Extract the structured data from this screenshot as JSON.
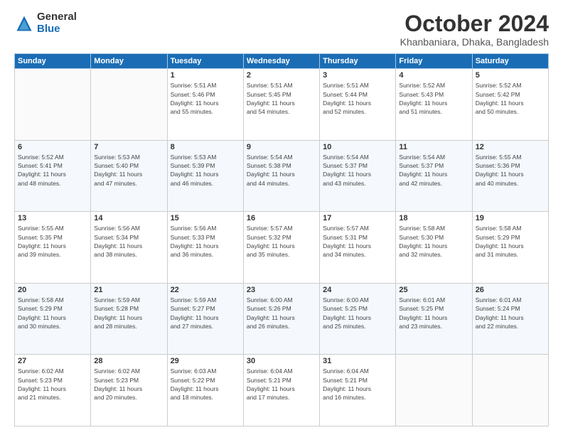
{
  "logo": {
    "general": "General",
    "blue": "Blue"
  },
  "header": {
    "month": "October 2024",
    "location": "Khanbaniara, Dhaka, Bangladesh"
  },
  "days_of_week": [
    "Sunday",
    "Monday",
    "Tuesday",
    "Wednesday",
    "Thursday",
    "Friday",
    "Saturday"
  ],
  "weeks": [
    [
      {
        "day": "",
        "info": ""
      },
      {
        "day": "",
        "info": ""
      },
      {
        "day": "1",
        "info": "Sunrise: 5:51 AM\nSunset: 5:46 PM\nDaylight: 11 hours\nand 55 minutes."
      },
      {
        "day": "2",
        "info": "Sunrise: 5:51 AM\nSunset: 5:45 PM\nDaylight: 11 hours\nand 54 minutes."
      },
      {
        "day": "3",
        "info": "Sunrise: 5:51 AM\nSunset: 5:44 PM\nDaylight: 11 hours\nand 52 minutes."
      },
      {
        "day": "4",
        "info": "Sunrise: 5:52 AM\nSunset: 5:43 PM\nDaylight: 11 hours\nand 51 minutes."
      },
      {
        "day": "5",
        "info": "Sunrise: 5:52 AM\nSunset: 5:42 PM\nDaylight: 11 hours\nand 50 minutes."
      }
    ],
    [
      {
        "day": "6",
        "info": "Sunrise: 5:52 AM\nSunset: 5:41 PM\nDaylight: 11 hours\nand 48 minutes."
      },
      {
        "day": "7",
        "info": "Sunrise: 5:53 AM\nSunset: 5:40 PM\nDaylight: 11 hours\nand 47 minutes."
      },
      {
        "day": "8",
        "info": "Sunrise: 5:53 AM\nSunset: 5:39 PM\nDaylight: 11 hours\nand 46 minutes."
      },
      {
        "day": "9",
        "info": "Sunrise: 5:54 AM\nSunset: 5:38 PM\nDaylight: 11 hours\nand 44 minutes."
      },
      {
        "day": "10",
        "info": "Sunrise: 5:54 AM\nSunset: 5:37 PM\nDaylight: 11 hours\nand 43 minutes."
      },
      {
        "day": "11",
        "info": "Sunrise: 5:54 AM\nSunset: 5:37 PM\nDaylight: 11 hours\nand 42 minutes."
      },
      {
        "day": "12",
        "info": "Sunrise: 5:55 AM\nSunset: 5:36 PM\nDaylight: 11 hours\nand 40 minutes."
      }
    ],
    [
      {
        "day": "13",
        "info": "Sunrise: 5:55 AM\nSunset: 5:35 PM\nDaylight: 11 hours\nand 39 minutes."
      },
      {
        "day": "14",
        "info": "Sunrise: 5:56 AM\nSunset: 5:34 PM\nDaylight: 11 hours\nand 38 minutes."
      },
      {
        "day": "15",
        "info": "Sunrise: 5:56 AM\nSunset: 5:33 PM\nDaylight: 11 hours\nand 36 minutes."
      },
      {
        "day": "16",
        "info": "Sunrise: 5:57 AM\nSunset: 5:32 PM\nDaylight: 11 hours\nand 35 minutes."
      },
      {
        "day": "17",
        "info": "Sunrise: 5:57 AM\nSunset: 5:31 PM\nDaylight: 11 hours\nand 34 minutes."
      },
      {
        "day": "18",
        "info": "Sunrise: 5:58 AM\nSunset: 5:30 PM\nDaylight: 11 hours\nand 32 minutes."
      },
      {
        "day": "19",
        "info": "Sunrise: 5:58 AM\nSunset: 5:29 PM\nDaylight: 11 hours\nand 31 minutes."
      }
    ],
    [
      {
        "day": "20",
        "info": "Sunrise: 5:58 AM\nSunset: 5:29 PM\nDaylight: 11 hours\nand 30 minutes."
      },
      {
        "day": "21",
        "info": "Sunrise: 5:59 AM\nSunset: 5:28 PM\nDaylight: 11 hours\nand 28 minutes."
      },
      {
        "day": "22",
        "info": "Sunrise: 5:59 AM\nSunset: 5:27 PM\nDaylight: 11 hours\nand 27 minutes."
      },
      {
        "day": "23",
        "info": "Sunrise: 6:00 AM\nSunset: 5:26 PM\nDaylight: 11 hours\nand 26 minutes."
      },
      {
        "day": "24",
        "info": "Sunrise: 6:00 AM\nSunset: 5:25 PM\nDaylight: 11 hours\nand 25 minutes."
      },
      {
        "day": "25",
        "info": "Sunrise: 6:01 AM\nSunset: 5:25 PM\nDaylight: 11 hours\nand 23 minutes."
      },
      {
        "day": "26",
        "info": "Sunrise: 6:01 AM\nSunset: 5:24 PM\nDaylight: 11 hours\nand 22 minutes."
      }
    ],
    [
      {
        "day": "27",
        "info": "Sunrise: 6:02 AM\nSunset: 5:23 PM\nDaylight: 11 hours\nand 21 minutes."
      },
      {
        "day": "28",
        "info": "Sunrise: 6:02 AM\nSunset: 5:23 PM\nDaylight: 11 hours\nand 20 minutes."
      },
      {
        "day": "29",
        "info": "Sunrise: 6:03 AM\nSunset: 5:22 PM\nDaylight: 11 hours\nand 18 minutes."
      },
      {
        "day": "30",
        "info": "Sunrise: 6:04 AM\nSunset: 5:21 PM\nDaylight: 11 hours\nand 17 minutes."
      },
      {
        "day": "31",
        "info": "Sunrise: 6:04 AM\nSunset: 5:21 PM\nDaylight: 11 hours\nand 16 minutes."
      },
      {
        "day": "",
        "info": ""
      },
      {
        "day": "",
        "info": ""
      }
    ]
  ]
}
